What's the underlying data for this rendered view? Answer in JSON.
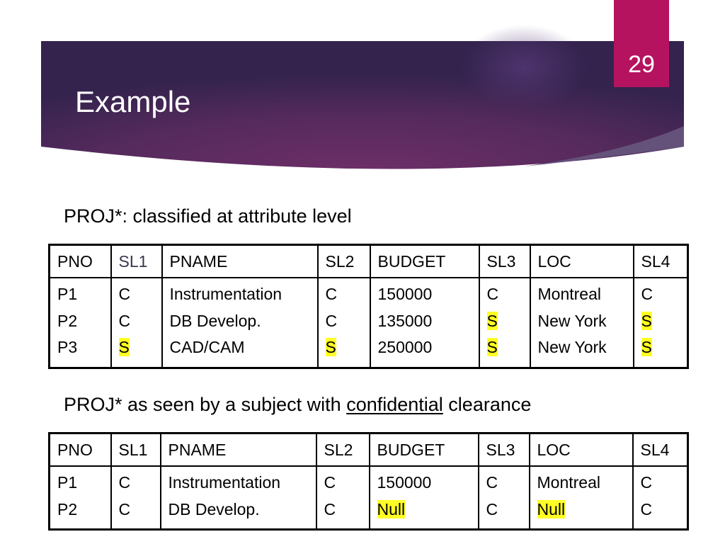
{
  "slide": {
    "number": "29",
    "title": "Example",
    "colors": {
      "banner_dark": "#34224f",
      "banner_mid": "#6a2d66",
      "accent_tab": "#b5135f",
      "highlight": "#ffff24"
    }
  },
  "table1": {
    "caption": "PROJ*: classified at attribute level",
    "headers": [
      "PNO",
      "SL1",
      "PNAME",
      "SL2",
      "BUDGET",
      "SL3",
      "LOC",
      "SL4"
    ],
    "rows": [
      [
        "P1",
        "C",
        "Instrumentation",
        "C",
        "150000",
        "C",
        "Montreal",
        "C"
      ],
      [
        "P2",
        "C",
        "DB Develop.",
        "C",
        "135000",
        "S",
        "New York",
        "S"
      ],
      [
        "P3",
        "S",
        "CAD/CAM",
        "S",
        "250000",
        "S",
        "New York",
        "S"
      ]
    ],
    "highlighted": [
      [
        2,
        1
      ],
      [
        2,
        3
      ],
      [
        1,
        5
      ],
      [
        2,
        5
      ],
      [
        1,
        7
      ],
      [
        2,
        7
      ]
    ]
  },
  "table2": {
    "caption_pre": "PROJ* as seen by a subject with ",
    "caption_emph": "confidential",
    "caption_post": " clearance",
    "headers": [
      "PNO",
      "SL1",
      "PNAME",
      "SL2",
      "BUDGET",
      "SL3",
      "LOC",
      "SL4"
    ],
    "rows": [
      [
        "P1",
        "C",
        "Instrumentation",
        "C",
        "150000",
        "C",
        "Montreal",
        "C"
      ],
      [
        "P2",
        "C",
        "DB Develop.",
        "C",
        "Null",
        "C",
        "Null",
        "C"
      ]
    ],
    "highlighted": [
      [
        1,
        4
      ],
      [
        1,
        6
      ]
    ]
  }
}
